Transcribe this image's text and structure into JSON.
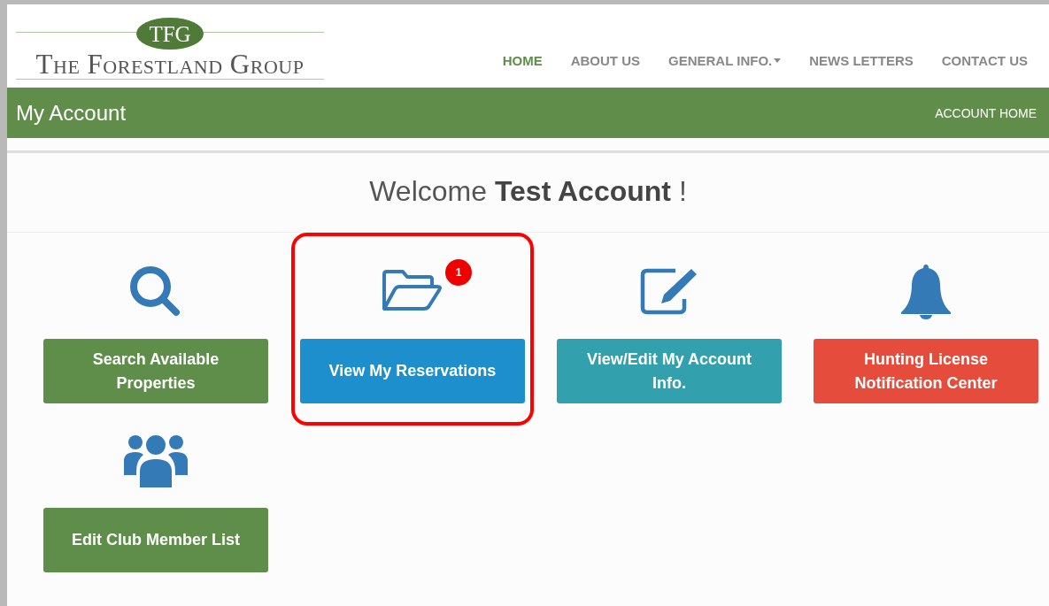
{
  "logo": {
    "mark": "TFG",
    "name": "The Forestland Group"
  },
  "nav": [
    {
      "label": "HOME",
      "selected": true,
      "dropdown": false
    },
    {
      "label": "ABOUT US",
      "selected": false,
      "dropdown": false
    },
    {
      "label": "GENERAL INFO.",
      "selected": false,
      "dropdown": true
    },
    {
      "label": "NEWS LETTERS",
      "selected": false,
      "dropdown": false
    },
    {
      "label": "CONTACT US",
      "selected": false,
      "dropdown": false
    }
  ],
  "title_bar": {
    "title": "My Account",
    "link": "ACCOUNT HOME"
  },
  "welcome": "Welcome **Test Account** !",
  "tiles": [
    {
      "kind": "search",
      "label": "Search Available Properties",
      "color": "#5f8d4a",
      "highlighted": false
    },
    {
      "kind": "folder",
      "label": "View My Reservations",
      "color": "#1e8fcd",
      "highlighted": true,
      "badge": "1"
    },
    {
      "kind": "edit",
      "label": "View/Edit My Account Info.",
      "color": "#33a0ad",
      "highlighted": false
    },
    {
      "kind": "bell",
      "label": "Hunting License Notification Center",
      "color": "#e54c3c",
      "highlighted": false
    },
    {
      "kind": "group",
      "label": "Edit Club Member List",
      "color": "#5f8d4a",
      "highlighted": false
    }
  ]
}
